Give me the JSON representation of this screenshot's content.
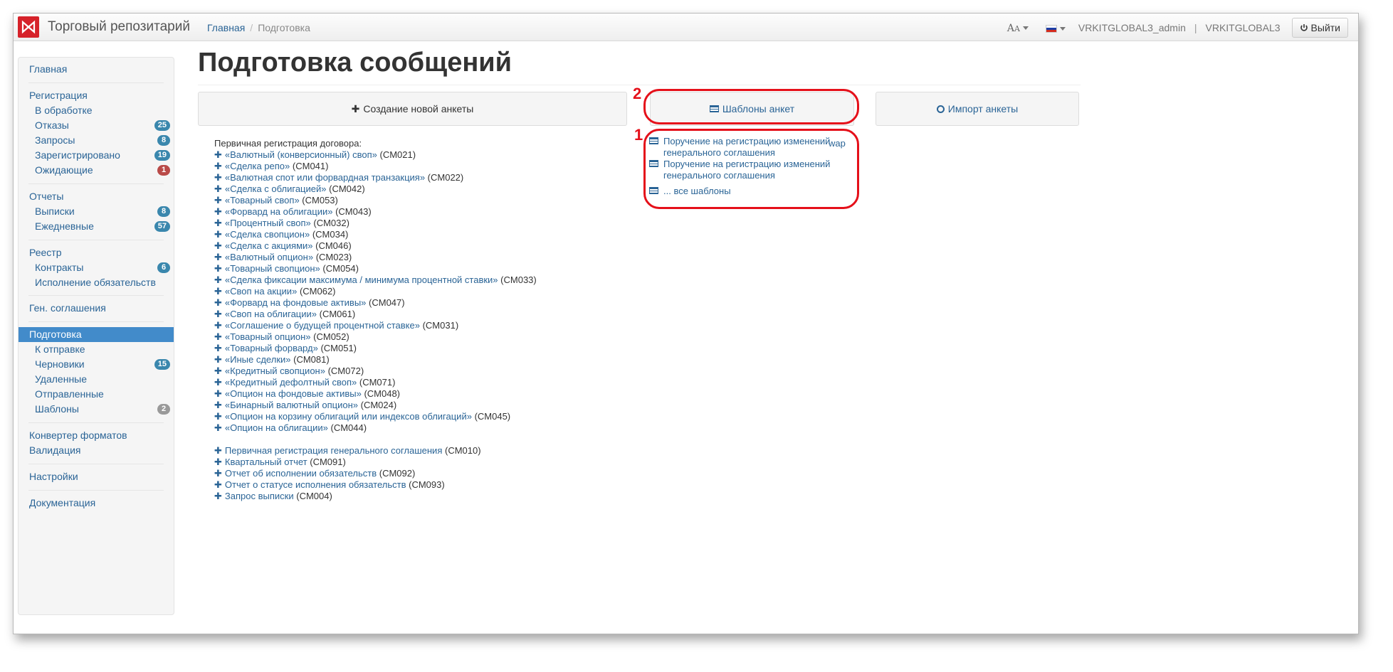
{
  "app": {
    "brand": "Торговый репозитарий",
    "logo_icon": "moex-logo-icon"
  },
  "breadcrumb": {
    "home": "Главная",
    "current": "Подготовка"
  },
  "topbar": {
    "font_size_label": "A",
    "font_size_small": "A",
    "user": "VRKITGLOBAL3_admin",
    "org": "VRKITGLOBAL3",
    "logout": "Выйти",
    "language_flag": "ru-flag-icon"
  },
  "sidebar": {
    "main": "Главная",
    "registration": "Регистрация",
    "reg_items": [
      {
        "label": "В обработке",
        "badge": ""
      },
      {
        "label": "Отказы",
        "badge": "25"
      },
      {
        "label": "Запросы",
        "badge": "8"
      },
      {
        "label": "Зарегистрировано",
        "badge": "19"
      },
      {
        "label": "Ожидающие",
        "badge": "1"
      }
    ],
    "reports": "Отчеты",
    "report_items": [
      {
        "label": "Выписки",
        "badge": "8"
      },
      {
        "label": "Ежедневные",
        "badge": "57"
      }
    ],
    "registry": "Реестр",
    "registry_items": [
      {
        "label": "Контракты",
        "badge": "6"
      },
      {
        "label": "Исполнение обязательств",
        "badge": ""
      }
    ],
    "gen_agreements": "Ген. соглашения",
    "preparation": "Подготовка",
    "prep_items": [
      {
        "label": "К отправке",
        "badge": ""
      },
      {
        "label": "Черновики",
        "badge": "15"
      },
      {
        "label": "Удаленные",
        "badge": ""
      },
      {
        "label": "Отправленные",
        "badge": ""
      },
      {
        "label": "Шаблоны",
        "badge": "2"
      }
    ],
    "converter": "Конвертер форматов",
    "validation": "Валидация",
    "settings": "Настройки",
    "documentation": "Документация"
  },
  "main": {
    "title": "Подготовка сообщений",
    "btn_create": "Создание новой анкеты",
    "btn_templates": "Шаблоны анкет",
    "btn_import": "Импорт анкеты",
    "annot_1": "1",
    "annot_2": "2",
    "list_head": "Первичная регистрация договора:",
    "contracts": [
      {
        "name": "«Валютный (конверсионный) своп»",
        "code": "(CM021)"
      },
      {
        "name": "«Сделка репо»",
        "code": "(CM041)"
      },
      {
        "name": "«Валютная спот или форвардная транзакция»",
        "code": "(CM022)"
      },
      {
        "name": "«Сделка с облигацией»",
        "code": "(CM042)"
      },
      {
        "name": "«Товарный своп»",
        "code": "(CM053)"
      },
      {
        "name": "«Форвард на облигации»",
        "code": "(CM043)"
      },
      {
        "name": "«Процентный своп»",
        "code": "(CM032)"
      },
      {
        "name": "«Сделка свопцион»",
        "code": "(CM034)"
      },
      {
        "name": "«Сделка с акциями»",
        "code": "(CM046)"
      },
      {
        "name": "«Валютный опцион»",
        "code": "(CM023)"
      },
      {
        "name": "«Товарный свопцион»",
        "code": "(CM054)"
      },
      {
        "name": "«Сделка фиксации максимума / минимума процентной ставки»",
        "code": "(CM033)"
      },
      {
        "name": "«Своп на акции»",
        "code": "(CM062)"
      },
      {
        "name": "«Форвард на фондовые активы»",
        "code": "(CM047)"
      },
      {
        "name": "«Своп на облигации»",
        "code": "(CM061)"
      },
      {
        "name": "«Соглашение о будущей процентной ставке»",
        "code": "(CM031)"
      },
      {
        "name": "«Товарный опцион»",
        "code": "(CM052)"
      },
      {
        "name": "«Товарный форвард»",
        "code": "(CM051)"
      },
      {
        "name": "«Иные сделки»",
        "code": "(CM081)"
      },
      {
        "name": "«Кредитный свопцион»",
        "code": "(CM072)"
      },
      {
        "name": "«Кредитный дефолтный своп»",
        "code": "(CM071)"
      },
      {
        "name": "«Опцион на фондовые активы»",
        "code": "(CM048)"
      },
      {
        "name": "«Бинарный валютный опцион»",
        "code": "(CM024)"
      },
      {
        "name": "«Опцион на корзину облигаций или индексов облигаций»",
        "code": "(CM045)"
      },
      {
        "name": "«Опцион на облигации»",
        "code": "(CM044)"
      }
    ],
    "other": [
      {
        "name": "Первичная регистрация генерального соглашения",
        "code": "(CM010)"
      },
      {
        "name": "Квартальный отчет",
        "code": "(CM091)"
      },
      {
        "name": "Отчет об исполнении обязательств",
        "code": "(CM092)"
      },
      {
        "name": "Отчет о статусе исполнения обязательств",
        "code": "(CM093)"
      },
      {
        "name": "Запрос выписки",
        "code": "(CM004)"
      }
    ],
    "templates": [
      "Поручение на регистрацию изменений генерального соглашения",
      "Поручение на регистрацию изменений генерального соглашения",
      "... все шаблоны"
    ],
    "wap": "wap"
  },
  "colors": {
    "accent": "#428bca",
    "link": "#2a6496",
    "annotation": "#e5101a",
    "logo": "#d6222a"
  }
}
